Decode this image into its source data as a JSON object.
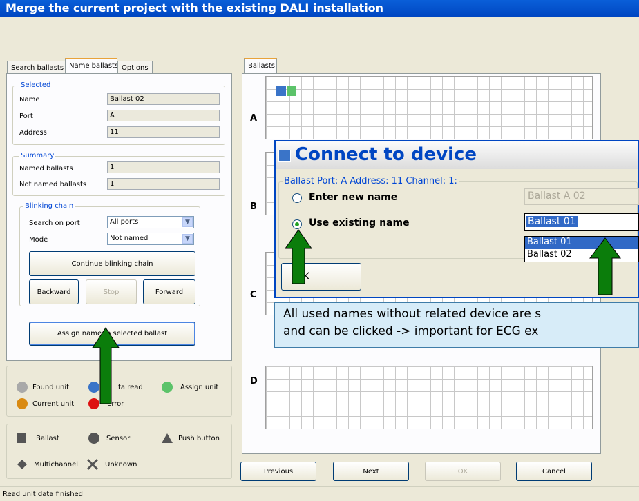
{
  "window": {
    "title": "Merge the current project with the existing DALI installation"
  },
  "left_tabs": [
    "Search ballasts",
    "Name ballasts",
    "Options"
  ],
  "selected": {
    "title": "Selected",
    "name_label": "Name",
    "name_value": "Ballast 02",
    "port_label": "Port",
    "port_value": "A",
    "address_label": "Address",
    "address_value": "11"
  },
  "summary": {
    "title": "Summary",
    "named_label": "Named ballasts",
    "named_value": "1",
    "not_named_label": "Not named ballasts",
    "not_named_value": "1"
  },
  "blinking": {
    "title": "Blinking chain",
    "search_port_label": "Search on port",
    "search_port_value": "All ports",
    "mode_label": "Mode",
    "mode_value": "Not named",
    "continue_label": "Continue blinking chain",
    "backward_label": "Backward",
    "stop_label": "Stop",
    "forward_label": "Forward"
  },
  "assign_button": "Assign name to selected ballast",
  "legend_status": {
    "found": "Found unit",
    "data_read": "Data read",
    "data_read_visible": "ta read",
    "assign": "Assign unit",
    "current": "Current unit",
    "error": "Error",
    "colors": {
      "found": "#a9a9a9",
      "data_read": "#3a74c8",
      "assign": "#5cc36a",
      "current": "#d98a12",
      "error": "#dd1111"
    }
  },
  "legend_types": {
    "ballast": "Ballast",
    "sensor": "Sensor",
    "push_button": "Push button",
    "multichannel": "Multichannel",
    "unknown": "Unknown"
  },
  "right_tab": "Ballasts",
  "grid_rows": [
    "A",
    "B",
    "C",
    "D"
  ],
  "bottom_buttons": {
    "previous": "Previous",
    "next": "Next",
    "ok": "OK",
    "cancel": "Cancel"
  },
  "status_bar": "Read unit data finished",
  "dialog": {
    "title": "Connect to device",
    "group_label": "Ballast Port: A Address: 11 Channel: 1:",
    "opt_new": "Enter new name",
    "opt_existing": "Use existing name",
    "new_name_value": "Ballast A 02",
    "existing_value": "Ballast 01",
    "list_items": [
      "Ballast 01",
      "Ballast 02"
    ],
    "ok_label": "OK"
  },
  "callout": {
    "line1": "All used names without related device are s",
    "line2": "and can be clicked -> important for ECG ex"
  },
  "colors": {
    "accent_arrow": "#0b7d0b",
    "title_bar": "#0046c2",
    "selection": "#3169c6"
  }
}
